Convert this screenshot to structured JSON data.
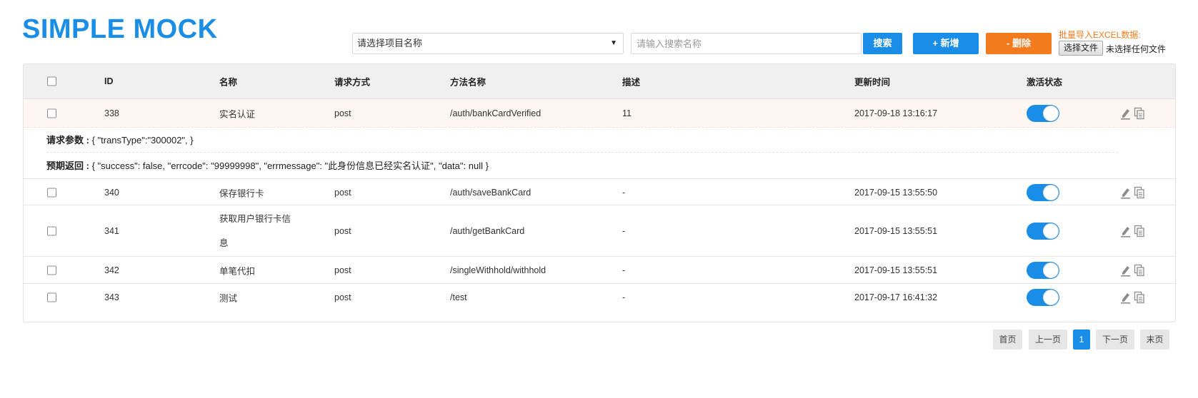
{
  "app": {
    "title": "SIMPLE MOCK"
  },
  "toolbar": {
    "project_select": "请选择项目名称",
    "search_placeholder": "请输入搜索名称",
    "search_label": "搜索",
    "add_label": "+ 新增",
    "delete_label": "- 删除",
    "import_label": "批量导入EXCEL数据:",
    "file_button": "选择文件",
    "file_status": "未选择任何文件"
  },
  "table": {
    "columns": [
      "ID",
      "名称",
      "请求方式",
      "方法名称",
      "描述",
      "更新时间",
      "激活状态"
    ],
    "rows": [
      {
        "id": "338",
        "name": "实名认证",
        "method": "post",
        "path": "/auth/bankCardVerified",
        "desc": "11",
        "time": "2017-09-18 13:16:17",
        "active": true
      },
      {
        "id": "340",
        "name": "保存银行卡",
        "method": "post",
        "path": "/auth/saveBankCard",
        "desc": "-",
        "time": "2017-09-15 13:55:50",
        "active": true
      },
      {
        "id": "341",
        "name": "获取用户银行卡信息",
        "method": "post",
        "path": "/auth/getBankCard",
        "desc": "-",
        "time": "2017-09-15 13:55:51",
        "active": true
      },
      {
        "id": "342",
        "name": "单笔代扣",
        "method": "post",
        "path": "/singleWithhold/withhold",
        "desc": "-",
        "time": "2017-09-15 13:55:51",
        "active": true
      },
      {
        "id": "343",
        "name": "测试",
        "method": "post",
        "path": "/test",
        "desc": "-",
        "time": "2017-09-17 16:41:32",
        "active": true
      }
    ],
    "detail": {
      "request_label": "请求参数 : ",
      "request_value": "{ \"transType\":\"300002\", }",
      "response_label": "预期返回 : ",
      "response_value": "{ \"success\": false, \"errcode\": \"99999998\", \"errmessage\": \"此身份信息已经实名认证\", \"data\": null }"
    }
  },
  "pagination": {
    "first": "首页",
    "prev": "上一页",
    "current": "1",
    "next": "下一页",
    "last": "末页"
  },
  "colors": {
    "primary": "#1a8ee6",
    "danger": "#f37b1d",
    "header_bg": "#f0f0f0",
    "highlight_row": "#fdf6f2"
  },
  "icons": {
    "edit": "edit-icon",
    "copy": "copy-icon",
    "caret": "chevron-down-icon"
  }
}
